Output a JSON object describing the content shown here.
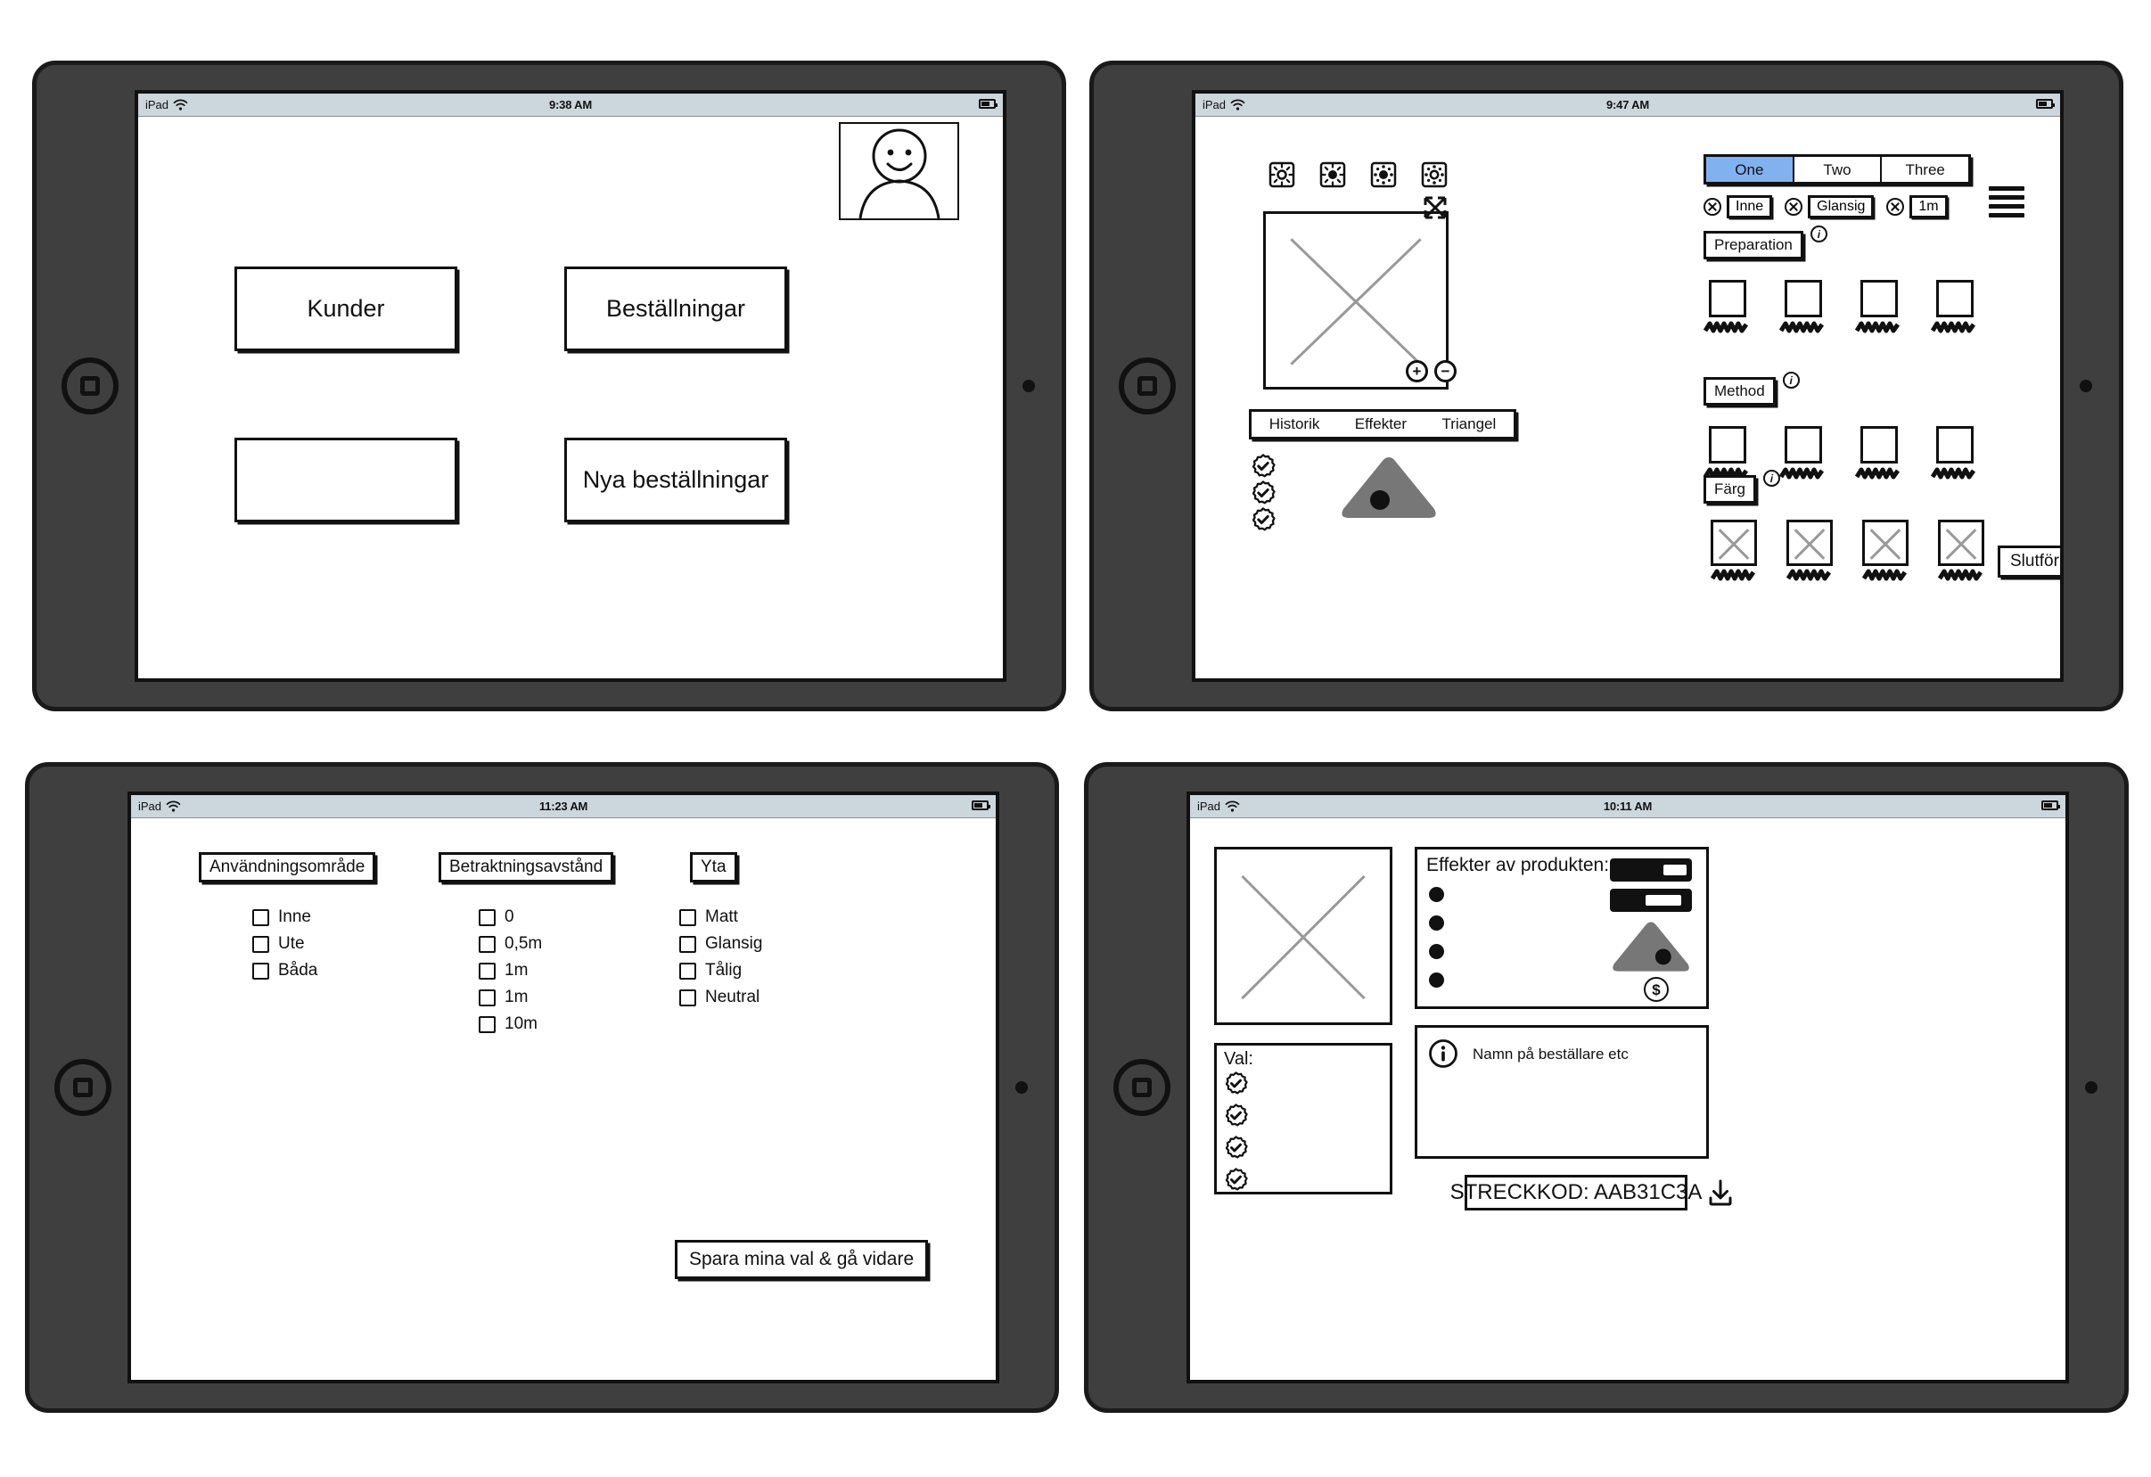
{
  "device": {
    "carrier_label": "iPad",
    "wifi_icon": "wifi-icon",
    "battery_icon": "battery-icon",
    "home_button_icon": "home-button-icon",
    "camera_icon": "camera-icon"
  },
  "screens": [
    {
      "id": "screen-dashboard",
      "status_time": "9:38 AM",
      "avatar": {
        "icon": "user-avatar-icon"
      },
      "tiles": [
        {
          "label": "Kunder"
        },
        {
          "label": "Beställningar"
        },
        {
          "label": ""
        },
        {
          "label": "Nya beställningar"
        }
      ]
    },
    {
      "id": "screen-configurator",
      "status_time": "9:47 AM",
      "brightness_icons": [
        "brightness-icon-1",
        "brightness-icon-2",
        "brightness-icon-3",
        "brightness-icon-4"
      ],
      "preview": {
        "placeholder_icon": "image-placeholder-icon",
        "expand_icon": "expand-arrows-icon",
        "zoom_in_label": "+",
        "zoom_out_label": "−"
      },
      "preview_tabs": [
        "Historik",
        "Effekter",
        "Triangel"
      ],
      "check_badges": [
        "check-badge-icon",
        "check-badge-icon",
        "check-badge-icon"
      ],
      "triangle_icon": "triangle-marker-icon",
      "segments": [
        {
          "label": "One",
          "selected": true
        },
        {
          "label": "Two",
          "selected": false
        },
        {
          "label": "Three",
          "selected": false
        }
      ],
      "filter_chips": [
        "Inne",
        "Glansig",
        "1m"
      ],
      "menu_icon": "hamburger-menu-icon",
      "sections": [
        {
          "title": "Preparation",
          "info_icon": "info-icon",
          "swatch_type": "empty-square",
          "count": 4
        },
        {
          "title": "Method",
          "info_icon": "info-icon",
          "swatch_type": "empty-square",
          "count": 4
        },
        {
          "title": "Färg",
          "info_icon": "info-icon",
          "swatch_type": "image-placeholder",
          "count": 4
        }
      ],
      "submit_label": "Slutför"
    },
    {
      "id": "screen-filters",
      "status_time": "11:23 AM",
      "groups": [
        {
          "title": "Användningsområde",
          "options": [
            "Inne",
            "Ute",
            "Båda"
          ]
        },
        {
          "title": "Betraktningsavstånd",
          "options": [
            "0",
            "0,5m",
            "1m",
            "1m",
            "10m"
          ]
        },
        {
          "title": "Yta",
          "options": [
            "Matt",
            "Glansig",
            "Tålig",
            "Neutral"
          ]
        }
      ],
      "save_label": "Spara mina val & gå vidare"
    },
    {
      "id": "screen-summary",
      "status_time": "10:11 AM",
      "preview_placeholder_icon": "image-placeholder-icon",
      "selection_panel": {
        "title": "Val:",
        "check_badges": [
          "check-badge-icon",
          "check-badge-icon",
          "check-badge-icon",
          "check-badge-icon"
        ]
      },
      "effects_panel": {
        "title": "Effekter av produkten:",
        "bullets": [
          "bullet-icon",
          "bullet-icon",
          "bullet-icon",
          "bullet-icon"
        ],
        "toggles": [
          "toggle-bar-icon",
          "toggle-bar-icon"
        ],
        "triangle_icon": "triangle-marker-icon",
        "price_icon": "dollar-coin-icon"
      },
      "notes_panel": {
        "info_icon": "info-icon",
        "placeholder": "Namn på beställare etc"
      },
      "barcode_label": "STRECKKOD: AAB31C3A",
      "download_icon": "download-icon"
    }
  ],
  "colors": {
    "accent_selected": "#82b1f0",
    "statusbar": "#ccd6dd",
    "frame": "#3f3f3f",
    "ink": "#111111",
    "placeholder_line": "#999999",
    "triangle_fill": "#777777"
  }
}
